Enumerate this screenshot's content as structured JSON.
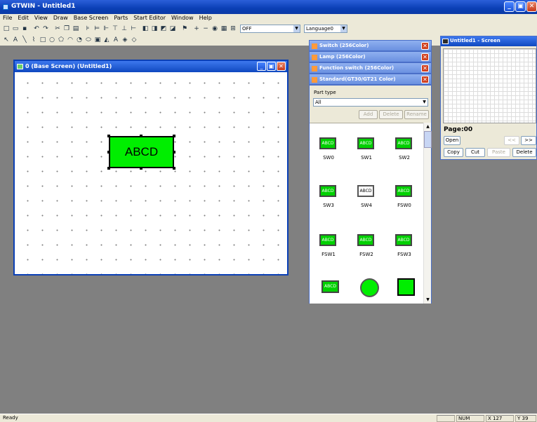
{
  "app": {
    "title": "GTWIN - Untitled1"
  },
  "menu": [
    "File",
    "Edit",
    "View",
    "Draw",
    "Base Screen",
    "Parts",
    "Start Editor",
    "Window",
    "Help"
  ],
  "toolbar": {
    "mode_value": "OFF",
    "language_value": "Language0"
  },
  "base_window": {
    "title": "0 (Base Screen) (Untitled1)"
  },
  "canvas": {
    "part_label": "ABCD"
  },
  "panels": {
    "switch": "Switch (256Color)",
    "lamp": "Lamp (256Color)",
    "function_switch": "Function switch (256Color)",
    "standard": "Standard(GT30/GT21 Color)"
  },
  "parts": {
    "type_label": "Part type",
    "type_value": "All",
    "add": "Add",
    "delete": "Delete",
    "rename": "Rename",
    "items": [
      {
        "name": "SW0",
        "text": "ABCD"
      },
      {
        "name": "SW1",
        "text": "ABCD"
      },
      {
        "name": "SW2",
        "text": "ABCD"
      },
      {
        "name": "SW3",
        "text": "ABCD"
      },
      {
        "name": "SW4",
        "text": "ABCD"
      },
      {
        "name": "FSW0",
        "text": "ABCD"
      },
      {
        "name": "FSW1",
        "text": "ABCD"
      },
      {
        "name": "FSW2",
        "text": "ABCD"
      },
      {
        "name": "FSW3",
        "text": "ABCD"
      }
    ],
    "small_text": "ABCD"
  },
  "preview": {
    "title": "Untitled1 - Screen",
    "page": "Page:00",
    "open": "Open",
    "prev": "<<",
    "next": ">>",
    "copy": "Copy",
    "cut": "Cut",
    "paste": "Paste",
    "delete": "Delete"
  },
  "status": {
    "text": "Ready",
    "num": "NUM",
    "x": "X 127",
    "y": "Y 39"
  }
}
